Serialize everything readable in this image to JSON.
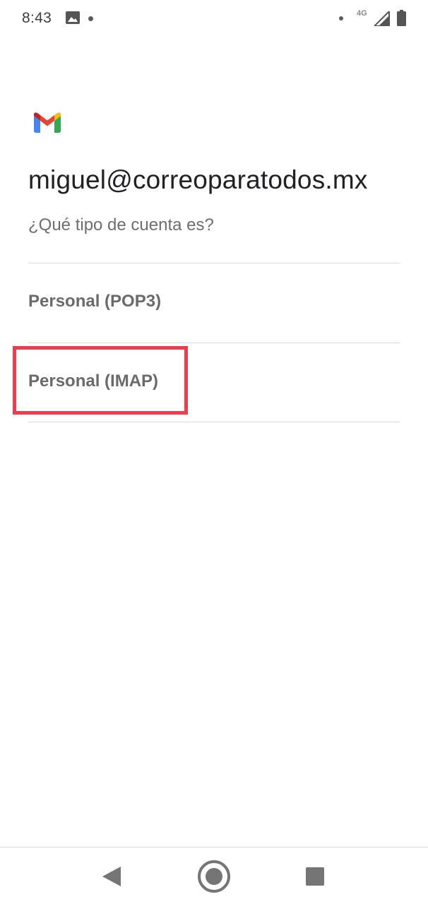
{
  "status_bar": {
    "time": "8:43",
    "network": "4G",
    "icons": [
      "image-icon",
      "dot-icon",
      "dot-icon",
      "signal-icon",
      "battery-icon"
    ]
  },
  "header": {
    "logo_icon": "gmail-logo-icon",
    "email": "miguel@correoparatodos.mx",
    "question": "¿Qué tipo de cuenta es?"
  },
  "options": [
    {
      "label": "Personal (POP3)"
    },
    {
      "label": "Personal (IMAP)",
      "highlighted": true
    }
  ],
  "nav_bar": {
    "icons": [
      "back-icon",
      "home-icon",
      "recents-icon"
    ]
  },
  "colors": {
    "highlight": "#f23a4d",
    "gmail_red": "#ea4335",
    "gmail_blue": "#4285f4",
    "gmail_green": "#34a853",
    "gmail_yellow": "#fbbc04"
  }
}
